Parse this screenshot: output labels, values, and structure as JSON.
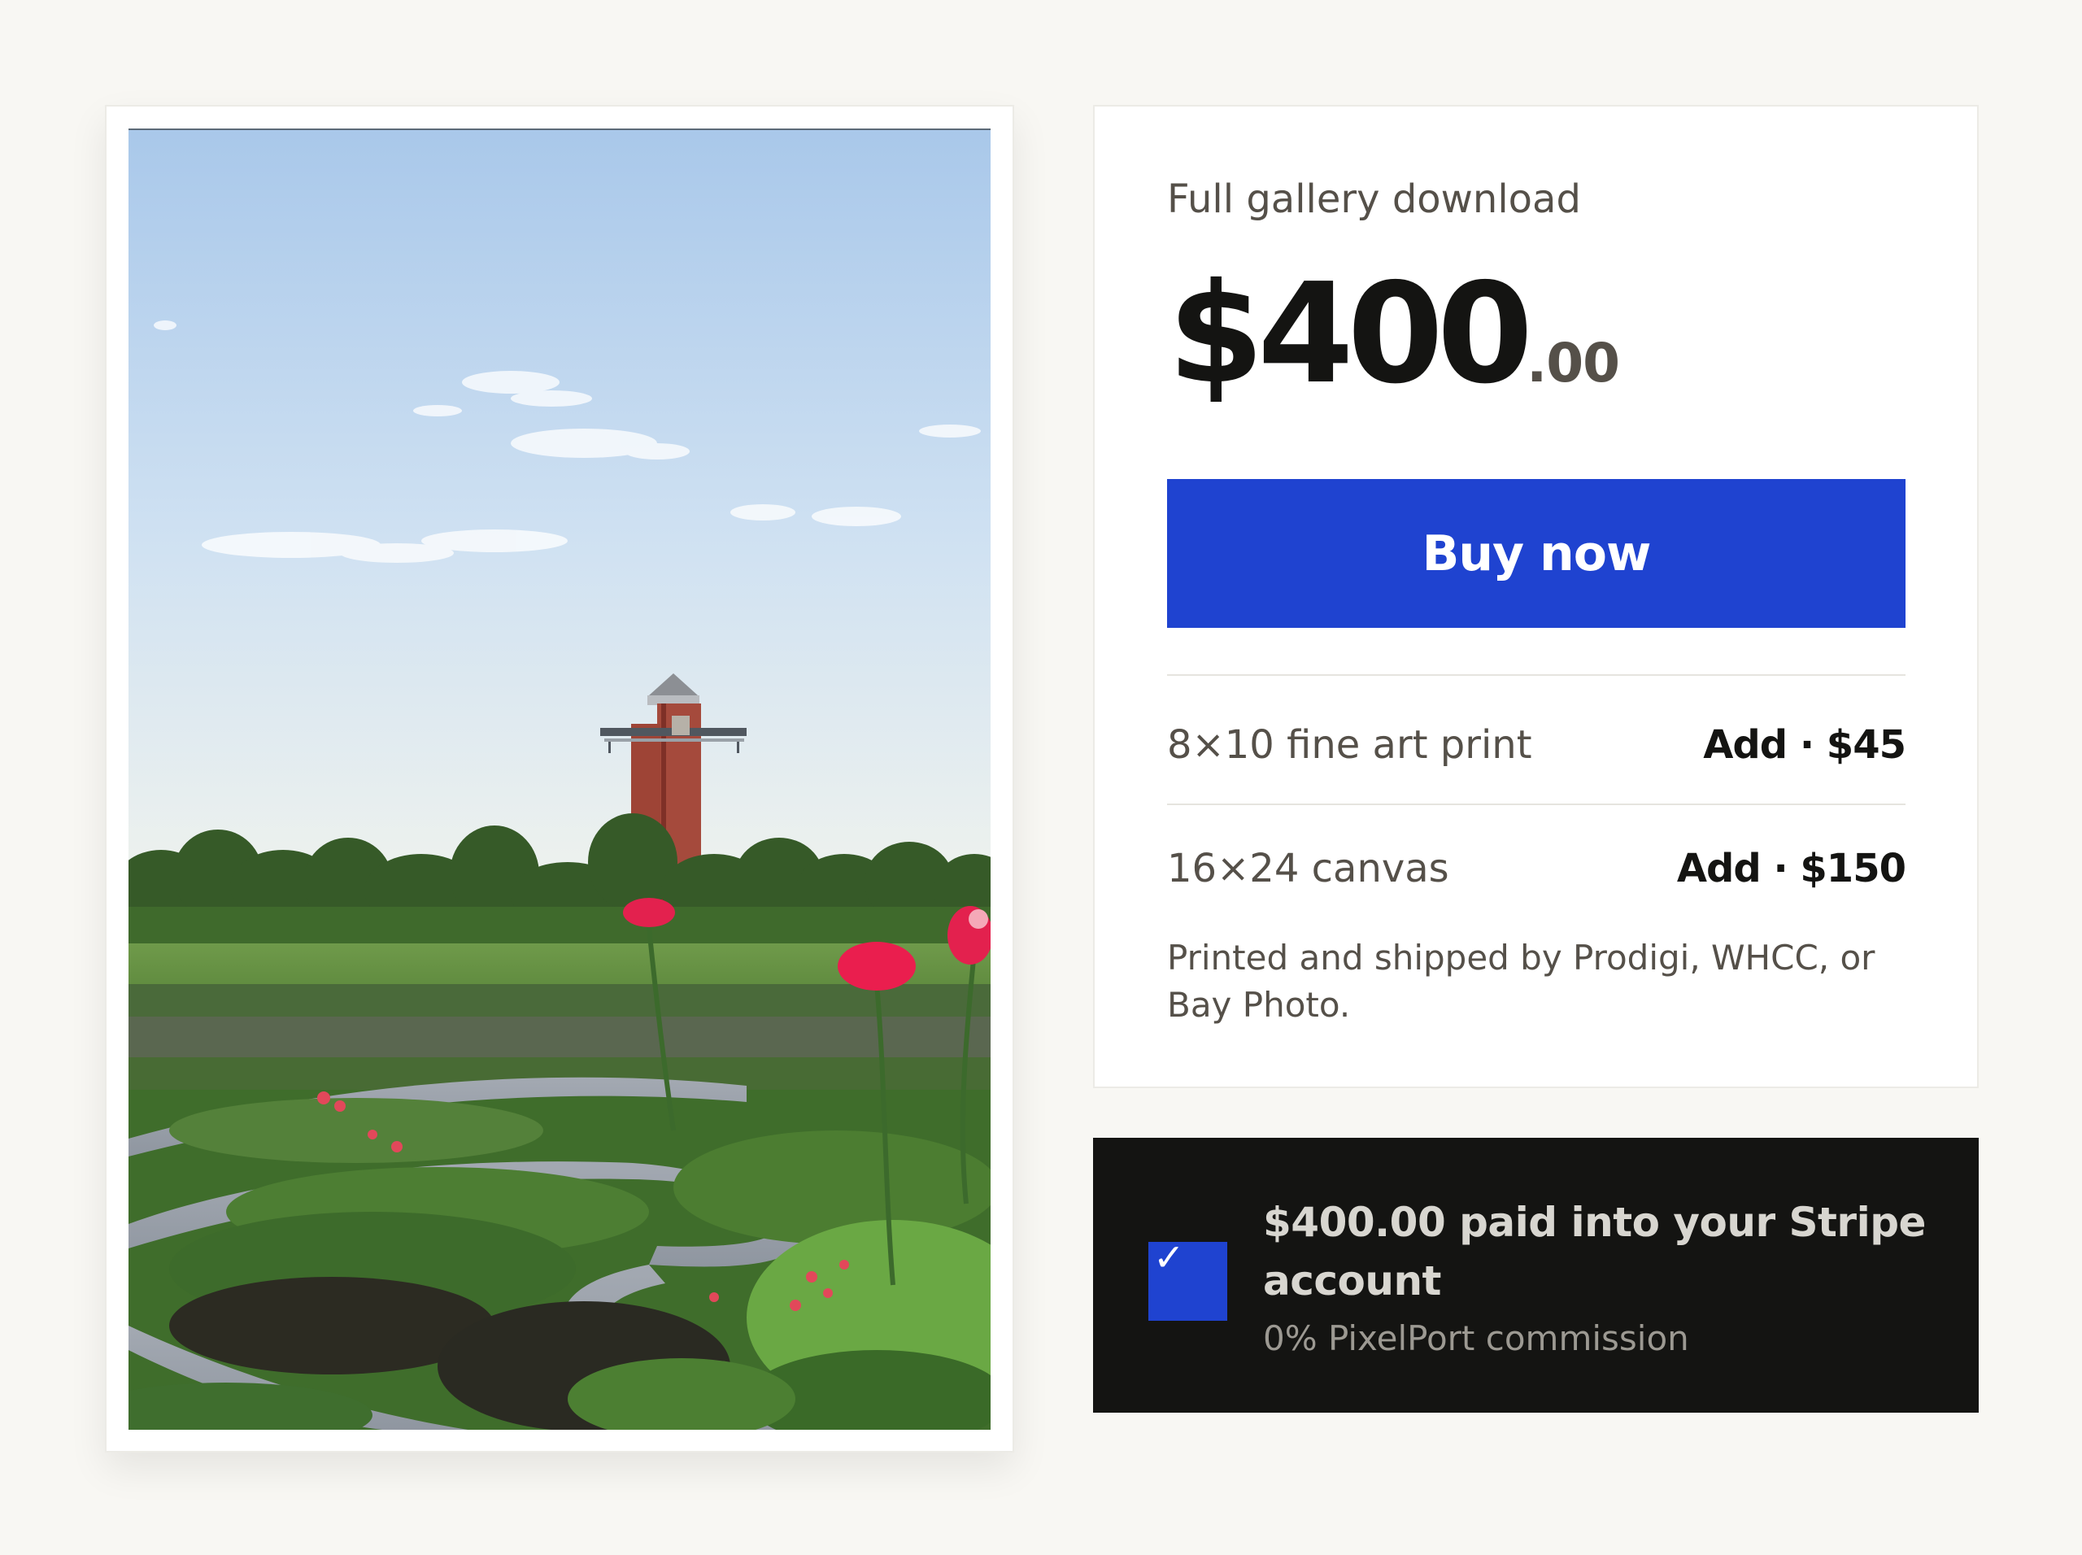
{
  "product": {
    "label": "Full gallery download",
    "price_whole": "$400",
    "price_cents": ".00",
    "buy_label": "Buy now"
  },
  "addons": [
    {
      "name": "8×10 fine art print",
      "action": "Add · $45"
    },
    {
      "name": "16×24 canvas",
      "action": "Add · $150"
    }
  ],
  "fulfillment_note": "Printed and shipped by Prodigi, WHCC, or Bay Photo.",
  "payout": {
    "title": "$400.00 paid into your Stripe account",
    "subtitle": "0% PixelPort commission",
    "check_icon": "checkmark-icon"
  },
  "photo": {
    "subject": "garden-path-with-observation-tower"
  },
  "colors": {
    "page_background": "#f8f7f3",
    "accent": "#1f43d0",
    "dark_panel": "#141412",
    "text_primary": "#141412",
    "text_secondary": "#555049"
  }
}
